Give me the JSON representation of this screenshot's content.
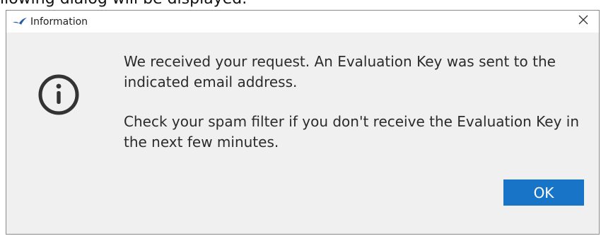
{
  "background": {
    "partial_text": "llowing dialog will be displayed."
  },
  "dialog": {
    "title": "Information",
    "app_icon": "swallow-logo-icon",
    "close_label": "×",
    "message_paragraphs": [
      "We received your request. An Evaluation Key was sent to the indicated email address.",
      "Check your spam filter if you don't receive the Evaluation Key in the next few minutes."
    ],
    "ok_label": "OK",
    "info_icon": "info-circle-icon"
  },
  "colors": {
    "dialog_background": "#f0f0f0",
    "titlebar_background": "#ffffff",
    "ok_button": "#1774c7",
    "icon_dark": "#333333",
    "app_icon": "#2a5fa8"
  }
}
